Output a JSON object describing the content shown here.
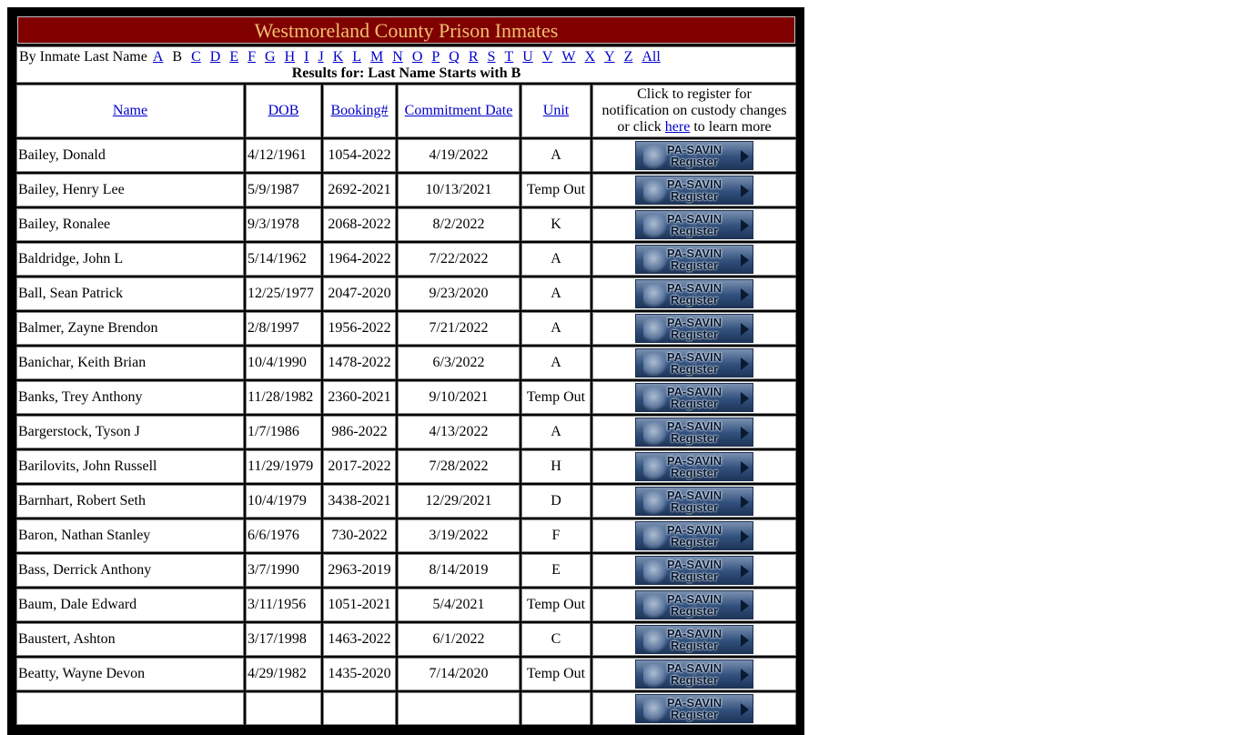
{
  "title": "Westmoreland County Prison Inmates",
  "alpha_nav": {
    "prefix": "By Inmate Last Name",
    "letters": [
      "A",
      "B",
      "C",
      "D",
      "E",
      "F",
      "G",
      "H",
      "I",
      "J",
      "K",
      "L",
      "M",
      "N",
      "O",
      "P",
      "Q",
      "R",
      "S",
      "T",
      "U",
      "V",
      "W",
      "X",
      "Y",
      "Z",
      "All"
    ],
    "current": "B",
    "results_text": "Results for: Last Name Starts with B"
  },
  "table": {
    "headers": {
      "name": "Name",
      "dob": "DOB",
      "booking": "Booking#",
      "commitment": "Commitment Date",
      "unit": "Unit",
      "register_line1": "Click to register for",
      "register_line2": "notification on custody changes",
      "register_prefix": "or click",
      "register_link": "here",
      "register_suffix": "to learn more"
    },
    "button": {
      "line1": "PA-SAVIN",
      "line2": "Register"
    },
    "rows": [
      {
        "name": "Bailey, Donald",
        "dob": "4/12/1961",
        "booking": "1054-2022",
        "commitment": "4/19/2022",
        "unit": "A"
      },
      {
        "name": "Bailey, Henry Lee",
        "dob": "5/9/1987",
        "booking": "2692-2021",
        "commitment": "10/13/2021",
        "unit": "Temp Out"
      },
      {
        "name": "Bailey, Ronalee",
        "dob": "9/3/1978",
        "booking": "2068-2022",
        "commitment": "8/2/2022",
        "unit": "K"
      },
      {
        "name": "Baldridge, John L",
        "dob": "5/14/1962",
        "booking": "1964-2022",
        "commitment": "7/22/2022",
        "unit": "A"
      },
      {
        "name": "Ball, Sean Patrick",
        "dob": "12/25/1977",
        "booking": "2047-2020",
        "commitment": "9/23/2020",
        "unit": "A"
      },
      {
        "name": "Balmer, Zayne Brendon",
        "dob": "2/8/1997",
        "booking": "1956-2022",
        "commitment": "7/21/2022",
        "unit": "A"
      },
      {
        "name": "Banichar, Keith Brian",
        "dob": "10/4/1990",
        "booking": "1478-2022",
        "commitment": "6/3/2022",
        "unit": "A"
      },
      {
        "name": "Banks, Trey Anthony",
        "dob": "11/28/1982",
        "booking": "2360-2021",
        "commitment": "9/10/2021",
        "unit": "Temp Out"
      },
      {
        "name": "Bargerstock, Tyson J",
        "dob": "1/7/1986",
        "booking": "986-2022",
        "commitment": "4/13/2022",
        "unit": "A"
      },
      {
        "name": "Barilovits, John Russell",
        "dob": "11/29/1979",
        "booking": "2017-2022",
        "commitment": "7/28/2022",
        "unit": "H"
      },
      {
        "name": "Barnhart, Robert Seth",
        "dob": "10/4/1979",
        "booking": "3438-2021",
        "commitment": "12/29/2021",
        "unit": "D"
      },
      {
        "name": "Baron, Nathan Stanley",
        "dob": "6/6/1976",
        "booking": "730-2022",
        "commitment": "3/19/2022",
        "unit": "F"
      },
      {
        "name": "Bass, Derrick Anthony",
        "dob": "3/7/1990",
        "booking": "2963-2019",
        "commitment": "8/14/2019",
        "unit": "E"
      },
      {
        "name": "Baum, Dale Edward",
        "dob": "3/11/1956",
        "booking": "1051-2021",
        "commitment": "5/4/2021",
        "unit": "Temp Out"
      },
      {
        "name": "Baustert, Ashton",
        "dob": "3/17/1998",
        "booking": "1463-2022",
        "commitment": "6/1/2022",
        "unit": "C"
      },
      {
        "name": "Beatty, Wayne Devon",
        "dob": "4/29/1982",
        "booking": "1435-2020",
        "commitment": "7/14/2020",
        "unit": "Temp Out"
      },
      {
        "name": "",
        "dob": "",
        "booking": "",
        "commitment": "",
        "unit": ""
      }
    ]
  }
}
